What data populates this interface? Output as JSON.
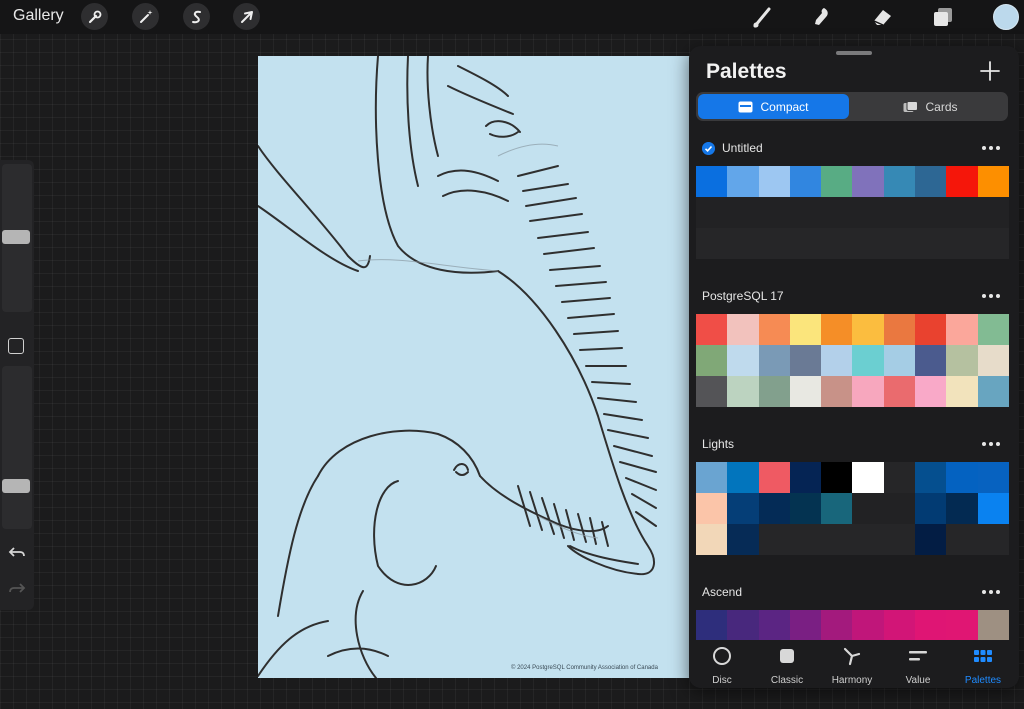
{
  "topbar": {
    "gallery_label": "Gallery",
    "left_tools": [
      "wrench-icon",
      "magic-wand-icon",
      "selection-s-icon",
      "transform-arrow-icon"
    ],
    "right_tools": [
      "brush-icon",
      "smudge-icon",
      "eraser-icon",
      "layers-icon"
    ],
    "current_color": "#bcd9ec"
  },
  "sidebar": {
    "brush_size_level": 0.51,
    "opacity_level": 0.19
  },
  "canvas": {
    "background": "#c3e1ef",
    "copyright": "© 2024 PostgreSQL Community Association of Canada"
  },
  "panel": {
    "title": "Palettes",
    "view_modes": [
      "Compact",
      "Cards"
    ],
    "active_mode": "Compact",
    "palettes": [
      {
        "name": "Untitled",
        "default": true,
        "rows": 3,
        "colors": [
          "#0a6fe0",
          "#62a6ea",
          "#9dc7f2",
          "#3186e0",
          "#58ac84",
          "#8072bb",
          "#3689b5",
          "#2d6794",
          "#f5160a",
          "#fd8f00"
        ]
      },
      {
        "name": "PostgreSQL 17",
        "default": false,
        "rows": 3,
        "colors": [
          "#f04e47",
          "#f2c2bd",
          "#f68b54",
          "#fbe57c",
          "#f58e27",
          "#fbbd3f",
          "#ea7840",
          "#e9422f",
          "#fba79b",
          "#82bb93",
          "#80a877",
          "#bfdaed",
          "#7a9ab6",
          "#6a7a95",
          "#b3d0ea",
          "#6bcfd1",
          "#a5cde5",
          "#4b5b8e",
          "#b5c1a0",
          "#e7dcca",
          "#545457",
          "#bcd3c0",
          "#82a08d",
          "#e8e8e2",
          "#c89288",
          "#f7a7be",
          "#ea6b6e",
          "#f9a9c8",
          "#f2e3bc",
          "#68a5c0"
        ]
      },
      {
        "name": "Lights",
        "default": false,
        "rows": 3,
        "colors": [
          "#6aa4d1",
          "#0275bd",
          "#ef5a63",
          "#052454",
          "#000000",
          "#ffffff",
          "",
          "#054f8f",
          "#0462c1",
          "#0762c0",
          "#fbc5a9",
          "#053e77",
          "#042b56",
          "#043351",
          "#18667b",
          "",
          "",
          "#023b73",
          "#032a52",
          "#0a82f0",
          "#f2d7b8",
          "#062b56",
          "",
          "",
          "",
          "",
          "",
          "#031d44",
          "",
          ""
        ]
      },
      {
        "name": "Ascend",
        "default": false,
        "rows": 1,
        "colors": [
          "#2e2e7c",
          "#48287d",
          "#5b2583",
          "#7a1f83",
          "#a31a7d",
          "#c0167a",
          "#d21577",
          "#df1574",
          "#e01673",
          "#9e9082"
        ]
      }
    ],
    "tabs": [
      {
        "label": "Disc",
        "icon": "disc-icon"
      },
      {
        "label": "Classic",
        "icon": "classic-square-icon"
      },
      {
        "label": "Harmony",
        "icon": "harmony-icon"
      },
      {
        "label": "Value",
        "icon": "value-sliders-icon"
      },
      {
        "label": "Palettes",
        "icon": "palettes-grid-icon"
      }
    ],
    "active_tab": "Palettes"
  }
}
